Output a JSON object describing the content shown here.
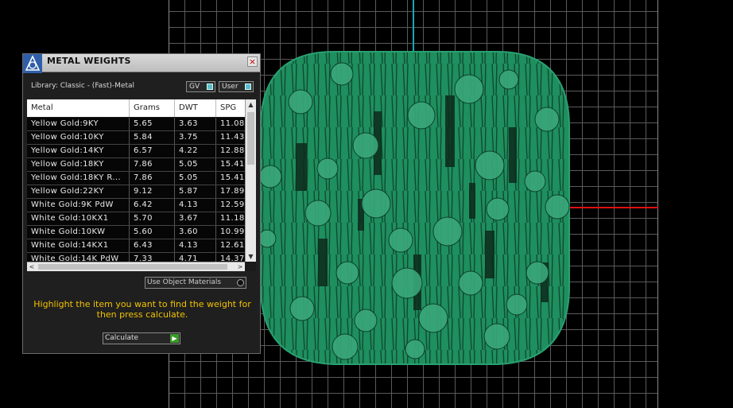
{
  "panel": {
    "title": "METAL WEIGHTS",
    "close_label": "×",
    "library_label": "Library: Classic - (Fast)-Metal",
    "toggles": {
      "gv": "GV",
      "user": "User"
    },
    "columns": [
      "Metal",
      "Grams",
      "DWT",
      "SPG"
    ],
    "rows": [
      [
        "Yellow Gold:9KY",
        "5.65",
        "3.63",
        "11.08"
      ],
      [
        "Yellow Gold:10KY",
        "5.84",
        "3.75",
        "11.43"
      ],
      [
        "Yellow Gold:14KY",
        "6.57",
        "4.22",
        "12.88"
      ],
      [
        "Yellow Gold:18KY",
        "7.86",
        "5.05",
        "15.41"
      ],
      [
        "Yellow Gold:18KY R...",
        "7.86",
        "5.05",
        "15.41"
      ],
      [
        "Yellow Gold:22KY",
        "9.12",
        "5.87",
        "17.89"
      ],
      [
        "White Gold:9K PdW",
        "6.42",
        "4.13",
        "12.59"
      ],
      [
        "White Gold:10KX1",
        "5.70",
        "3.67",
        "11.18"
      ],
      [
        "White Gold:10KW",
        "5.60",
        "3.60",
        "10.99"
      ],
      [
        "White Gold:14KX1",
        "6.43",
        "4.13",
        "12.61"
      ],
      [
        "White Gold:14K PdW",
        "7.33",
        "4.71",
        "14.37"
      ]
    ],
    "scroll_up": "▲",
    "scroll_down": "▼",
    "scroll_left": "<",
    "scroll_right": ">",
    "use_object_materials": "Use Object Materials",
    "instructions": "Highlight the item you want to find the weight for then press calculate.",
    "calculate_label": "Calculate",
    "calculate_go": "▶"
  },
  "colors": {
    "model_green": "#1e8f5e",
    "instruction_text": "#f2c200",
    "axis_x": "#dd1111",
    "axis_y": "#17a8b8"
  }
}
